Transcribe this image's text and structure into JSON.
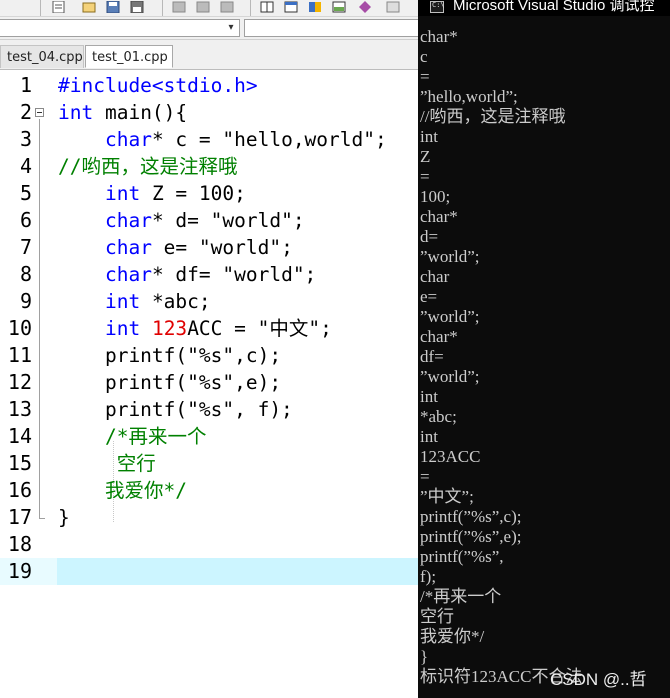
{
  "tabs": [
    {
      "label": "test_04.cpp",
      "active": false
    },
    {
      "label": "test_01.cpp",
      "active": true
    }
  ],
  "editor": {
    "lines": [
      {
        "n": "1",
        "tokens": [
          {
            "t": "#include<stdio.h>",
            "c": "pp"
          }
        ]
      },
      {
        "n": "2",
        "tokens": [
          {
            "t": "int",
            "c": "kw"
          },
          {
            "t": " main(){",
            "c": ""
          }
        ]
      },
      {
        "n": "3",
        "tokens": [
          {
            "t": "    ",
            "c": ""
          },
          {
            "t": "char",
            "c": "kw"
          },
          {
            "t": "* c = \"hello,world\";",
            "c": ""
          }
        ]
      },
      {
        "n": "4",
        "tokens": [
          {
            "t": "//哟西，这是注释哦",
            "c": "cm"
          }
        ]
      },
      {
        "n": "5",
        "tokens": [
          {
            "t": "    ",
            "c": ""
          },
          {
            "t": "int",
            "c": "kw"
          },
          {
            "t": " Z = 100;",
            "c": ""
          }
        ]
      },
      {
        "n": "6",
        "tokens": [
          {
            "t": "    ",
            "c": ""
          },
          {
            "t": "char",
            "c": "kw"
          },
          {
            "t": "* d= \"world\";",
            "c": ""
          }
        ]
      },
      {
        "n": "7",
        "tokens": [
          {
            "t": "    ",
            "c": ""
          },
          {
            "t": "char",
            "c": "kw"
          },
          {
            "t": " e= \"world\";",
            "c": ""
          }
        ]
      },
      {
        "n": "8",
        "tokens": [
          {
            "t": "    ",
            "c": ""
          },
          {
            "t": "char",
            "c": "kw"
          },
          {
            "t": "* df= \"world\";",
            "c": ""
          }
        ]
      },
      {
        "n": "9",
        "tokens": [
          {
            "t": "    ",
            "c": ""
          },
          {
            "t": "int",
            "c": "kw"
          },
          {
            "t": " *abc;",
            "c": ""
          }
        ]
      },
      {
        "n": "10",
        "tokens": [
          {
            "t": "    ",
            "c": ""
          },
          {
            "t": "int",
            "c": "kw"
          },
          {
            "t": " ",
            "c": ""
          },
          {
            "t": "123",
            "c": "num"
          },
          {
            "t": "ACC = \"中文\";",
            "c": ""
          }
        ]
      },
      {
        "n": "11",
        "tokens": [
          {
            "t": "    printf(\"%s\",c);",
            "c": ""
          }
        ]
      },
      {
        "n": "12",
        "tokens": [
          {
            "t": "    printf(\"%s\",e);",
            "c": ""
          }
        ]
      },
      {
        "n": "13",
        "tokens": [
          {
            "t": "    printf(\"%s\", f);",
            "c": ""
          }
        ]
      },
      {
        "n": "14",
        "tokens": [
          {
            "t": "    ",
            "c": ""
          },
          {
            "t": "/*再来一个",
            "c": "cm"
          }
        ]
      },
      {
        "n": "15",
        "tokens": [
          {
            "t": "     ",
            "c": ""
          },
          {
            "t": "空行",
            "c": "cm"
          }
        ]
      },
      {
        "n": "16",
        "tokens": [
          {
            "t": "    ",
            "c": ""
          },
          {
            "t": "我爱你*/",
            "c": "cm"
          }
        ]
      },
      {
        "n": "17",
        "tokens": [
          {
            "t": "}",
            "c": ""
          }
        ]
      },
      {
        "n": "18",
        "tokens": []
      },
      {
        "n": "19",
        "tokens": [],
        "highlight": true
      }
    ]
  },
  "console": {
    "title": "Microsoft Visual Studio 调试控",
    "icon_label": "C:\\",
    "output": [
      "char*",
      "c",
      "=",
      "”hello,world”;",
      "//哟西，这是注释哦",
      "int",
      "Z",
      "=",
      "100;",
      "char*",
      "d=",
      "”world”;",
      "char",
      "e=",
      "”world”;",
      "char*",
      "df=",
      "”world”;",
      "int",
      "*abc;",
      "int",
      "123ACC",
      "=",
      "”中文”;",
      "printf(”%s”,c);",
      "printf(”%s”,e);",
      "printf(”%s”,",
      "f);",
      "/*再来一个",
      "空行",
      "我爱你*/",
      "}",
      "标识符123ACC不合法"
    ],
    "watermark": "CSDN @..哲"
  },
  "colors": {
    "keyword": "#0000ff",
    "comment": "#008000",
    "number": "#e00000",
    "console_bg": "#0c0c0c"
  }
}
